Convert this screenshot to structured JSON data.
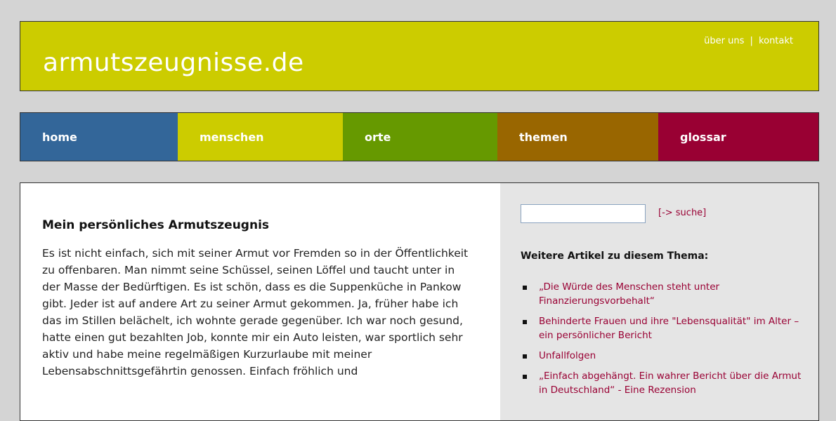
{
  "header": {
    "site_title": "armutszeugnisse.de",
    "link_about": "über uns",
    "separator": "|",
    "link_contact": "kontakt"
  },
  "nav": [
    {
      "label": "home",
      "color": "#336699"
    },
    {
      "label": "menschen",
      "color": "#cccc00"
    },
    {
      "label": "orte",
      "color": "#669900"
    },
    {
      "label": "themen",
      "color": "#996600"
    },
    {
      "label": "glossar",
      "color": "#990033"
    }
  ],
  "article": {
    "title": "Mein persönliches Armutszeugnis",
    "body": "Es ist nicht einfach, sich mit seiner Armut vor Fremden so in der Öffentlichkeit zu offenbaren. Man nimmt seine Schüssel, seinen Löffel und taucht unter in der Masse der Bedürftigen. Es ist schön, dass es die Suppenküche in Pankow gibt. Jeder ist auf andere Art zu seiner Armut gekommen. Ja, früher habe ich das im Stillen belächelt, ich wohnte gerade gegenüber. Ich war noch gesund, hatte einen gut bezahlten Job, konnte mir ein Auto leisten, war sportlich sehr aktiv und habe meine regelmäßigen Kurzurlaube mit meiner Lebensabschnittsgefährtin genossen. Einfach fröhlich und"
  },
  "sidebar": {
    "search_value": "",
    "search_link": "[-> suche]",
    "related_heading": "Weitere Artikel zu diesem Thema:",
    "related": [
      "„Die Würde des Menschen steht unter Finanzierungsvorbehalt“",
      "Behinderte Frauen und ihre \"Lebensqualität\" im Alter – ein persönlicher Bericht",
      "Unfallfolgen",
      "„Einfach abgehängt. Ein wahrer Bericht über die Armut in Deutschland“ - Eine Rezension"
    ]
  }
}
